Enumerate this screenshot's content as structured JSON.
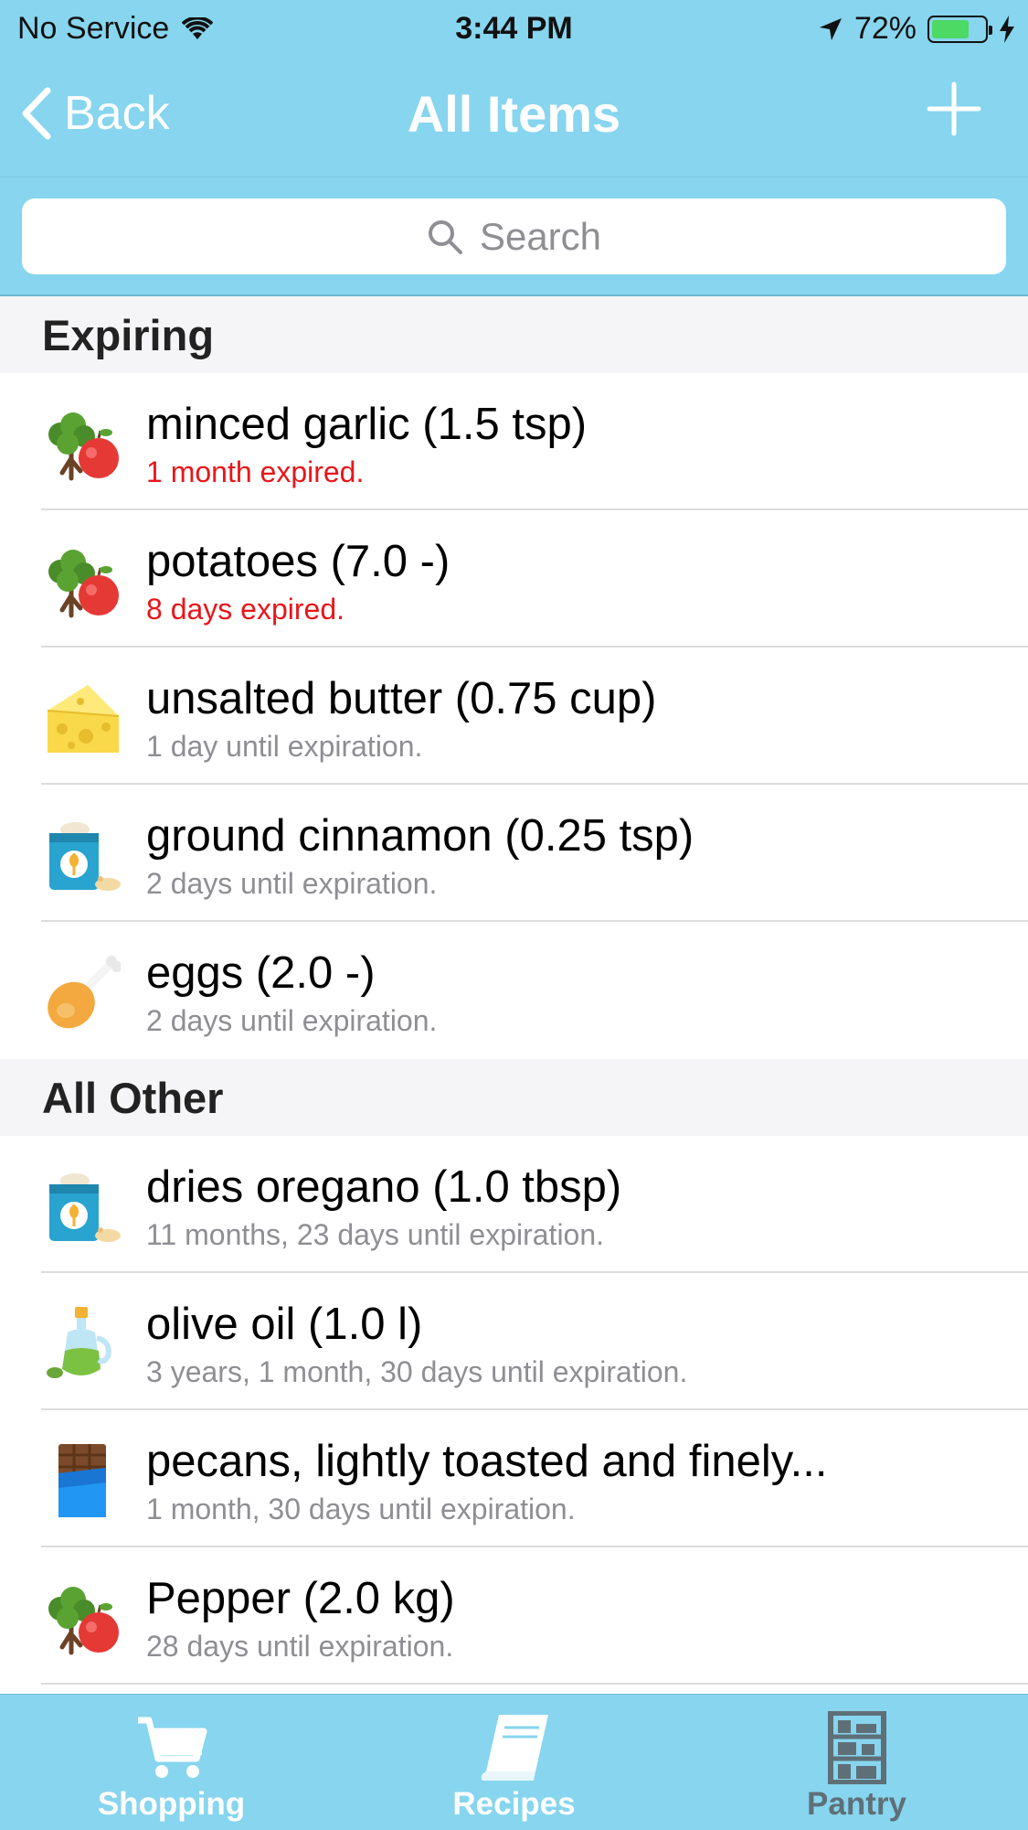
{
  "status_bar": {
    "carrier": "No Service",
    "time": "3:44 PM",
    "battery": "72%",
    "battery_level": 0.72
  },
  "nav": {
    "back_label": "Back",
    "title": "All Items"
  },
  "search": {
    "placeholder": "Search"
  },
  "sections": [
    {
      "title": "Expiring",
      "items": [
        {
          "name": "minced garlic (1.5 tsp)",
          "detail": "1 month expired.",
          "expired": true,
          "icon": "produce-icon"
        },
        {
          "name": "potatoes (7.0 -)",
          "detail": "8 days expired.",
          "expired": true,
          "icon": "produce-icon"
        },
        {
          "name": "unsalted butter (0.75 cup)",
          "detail": "1 day until expiration.",
          "expired": false,
          "icon": "cheese-icon"
        },
        {
          "name": "ground cinnamon (0.25 tsp)",
          "detail": "2 days until expiration.",
          "expired": false,
          "icon": "flour-bag-icon"
        },
        {
          "name": "eggs (2.0 -)",
          "detail": "2 days until expiration.",
          "expired": false,
          "icon": "chicken-leg-icon"
        }
      ]
    },
    {
      "title": "All Other",
      "items": [
        {
          "name": "dries oregano (1.0 tbsp)",
          "detail": "11 months, 23 days until expiration.",
          "expired": false,
          "icon": "flour-bag-icon"
        },
        {
          "name": "olive oil (1.0 l)",
          "detail": "3 years, 1 month, 30 days until expiration.",
          "expired": false,
          "icon": "oil-bottle-icon"
        },
        {
          "name": "pecans, lightly toasted and finely...",
          "detail": "1 month, 30 days until expiration.",
          "expired": false,
          "icon": "chocolate-bar-icon"
        },
        {
          "name": "Pepper (2.0 kg)",
          "detail": "28 days until expiration.",
          "expired": false,
          "icon": "produce-icon"
        }
      ]
    }
  ],
  "tabs": [
    {
      "label": "Shopping",
      "icon": "cart-icon",
      "active": false
    },
    {
      "label": "Recipes",
      "icon": "book-icon",
      "active": false
    },
    {
      "label": "Pantry",
      "icon": "shelves-icon",
      "active": true
    }
  ],
  "colors": {
    "bar": "#87d5ee",
    "expired": "#e8161b",
    "subtext": "#8e8e93",
    "active_tab": "#5f6f78"
  }
}
